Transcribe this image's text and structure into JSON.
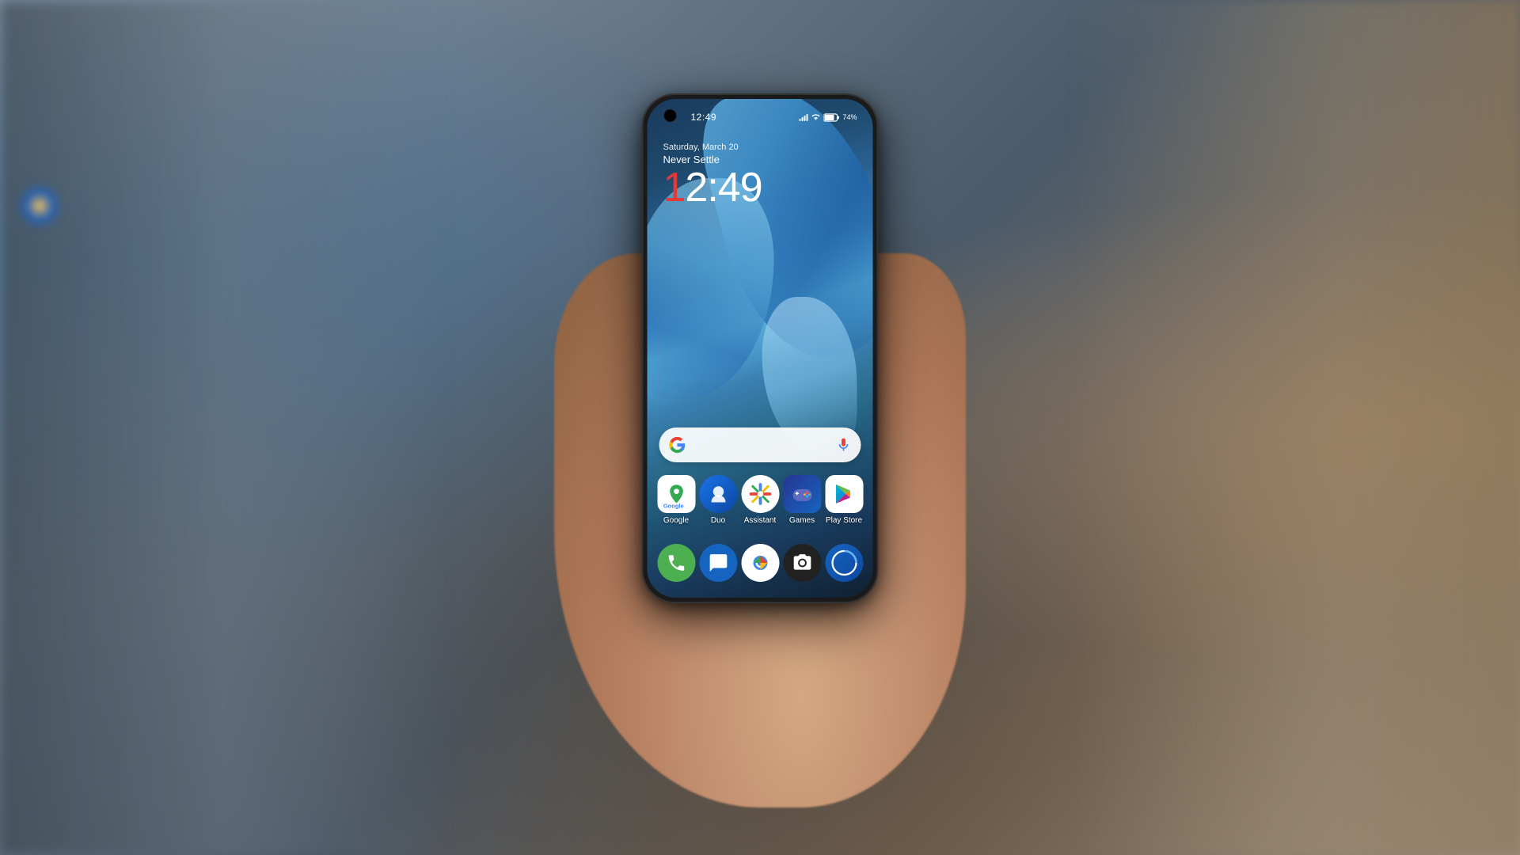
{
  "background": {
    "description": "Blurred subway station background, hand holding phone"
  },
  "phone": {
    "status_bar": {
      "time": "12:49",
      "battery": "74%",
      "battery_icon": "battery-icon",
      "signal_icon": "signal-icon",
      "wifi_icon": "wifi-icon"
    },
    "lockscreen": {
      "date": "Saturday, March 20",
      "tagline": "Never Settle",
      "clock": "12:49"
    },
    "search_bar": {
      "placeholder": "",
      "google_label": "G",
      "mic_label": "mic"
    },
    "app_grid": {
      "apps": [
        {
          "name": "Google",
          "icon_type": "google-maps"
        },
        {
          "name": "Duo",
          "icon_type": "duo"
        },
        {
          "name": "Assistant",
          "icon_type": "assistant"
        },
        {
          "name": "Games",
          "icon_type": "games"
        },
        {
          "name": "Play Store",
          "icon_type": "playstore"
        }
      ]
    },
    "dock": {
      "apps": [
        {
          "name": "Phone",
          "icon_type": "phone"
        },
        {
          "name": "Messages",
          "icon_type": "messages"
        },
        {
          "name": "Chrome",
          "icon_type": "chrome"
        },
        {
          "name": "Camera",
          "icon_type": "camera"
        },
        {
          "name": "OnePlus",
          "icon_type": "oneplus"
        }
      ]
    }
  }
}
